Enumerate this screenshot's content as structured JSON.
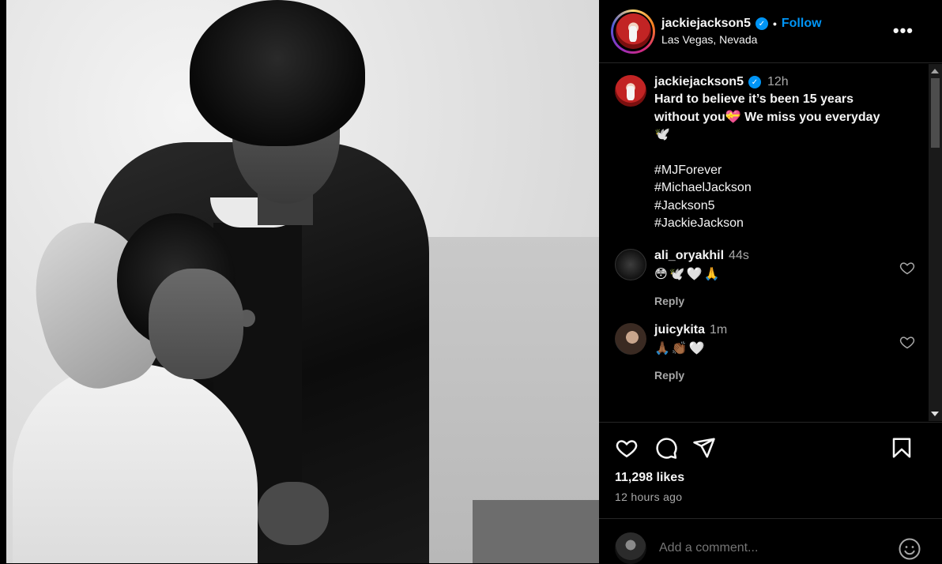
{
  "post": {
    "username": "jackiejackson5",
    "verified_mark": "✓",
    "follow_label": "Follow",
    "separator": "•",
    "location": "Las Vegas, Nevada",
    "more_label": "•••"
  },
  "caption": {
    "username": "jackiejackson5",
    "time": "12h",
    "text": "Hard to believe it’s been 15 years without you💝 We miss you everyday🕊️",
    "hashtags": [
      "#MJForever",
      "#MichaelJackson",
      "#Jackson5",
      "#JackieJackson"
    ]
  },
  "comments": [
    {
      "username": "ali_oryakhil",
      "time": "44s",
      "text": "😳🕊️🤍🙏",
      "reply_label": "Reply"
    },
    {
      "username": "juicykita",
      "time": "1m",
      "text": "🙏🏾👏🏾🤍",
      "reply_label": "Reply"
    }
  ],
  "footer": {
    "likes": "11,298 likes",
    "posted": "12 hours ago",
    "add_comment_placeholder": "Add a comment..."
  },
  "icons": {
    "like": "heart-icon",
    "comment": "comment-icon",
    "share": "paper-plane-icon",
    "save": "bookmark-icon",
    "emoji": "smiley-icon",
    "more": "more-icon"
  },
  "colors": {
    "background": "#000000",
    "accent": "#0095f6",
    "secondary_text": "#a8a8a8",
    "divider": "#262626"
  }
}
